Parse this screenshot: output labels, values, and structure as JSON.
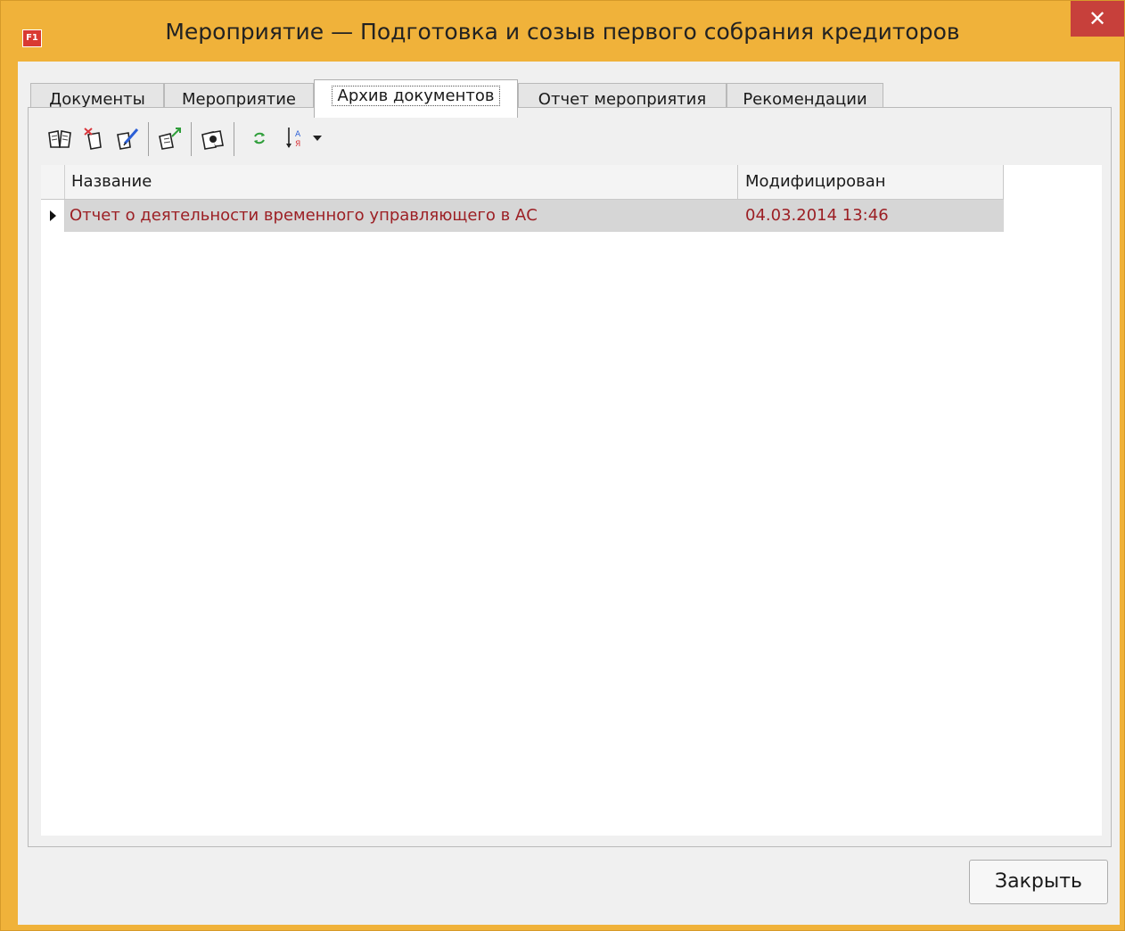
{
  "window": {
    "title": "Мероприятие — Подготовка и созыв первого собрания кредиторов",
    "app_icon_text": "F1",
    "close_glyph": "✕"
  },
  "tabs": [
    {
      "label": "Документы",
      "active": false
    },
    {
      "label": "Мероприятие",
      "active": false
    },
    {
      "label": "Архив документов",
      "active": true
    },
    {
      "label": "Отчет мероприятия",
      "active": false
    },
    {
      "label": "Рекомендации",
      "active": false
    }
  ],
  "toolbar": {
    "icons": [
      "open-book-icon",
      "delete-document-icon",
      "edit-document-icon",
      "export-document-icon",
      "view-document-icon",
      "refresh-icon",
      "sort-az-icon",
      "dropdown-arrow-icon"
    ]
  },
  "grid": {
    "columns": [
      "Название",
      "Модифицирован"
    ],
    "rows": [
      {
        "name": "Отчет о деятельности временного управляющего в АС",
        "modified": "04.03.2014 13:46"
      }
    ]
  },
  "buttons": {
    "close_label": "Закрыть"
  },
  "colors": {
    "window_frame": "#f0b23a",
    "close_button": "#c7403b",
    "row_text": "#9c1f24",
    "selected_row": "#d6d6d6"
  }
}
